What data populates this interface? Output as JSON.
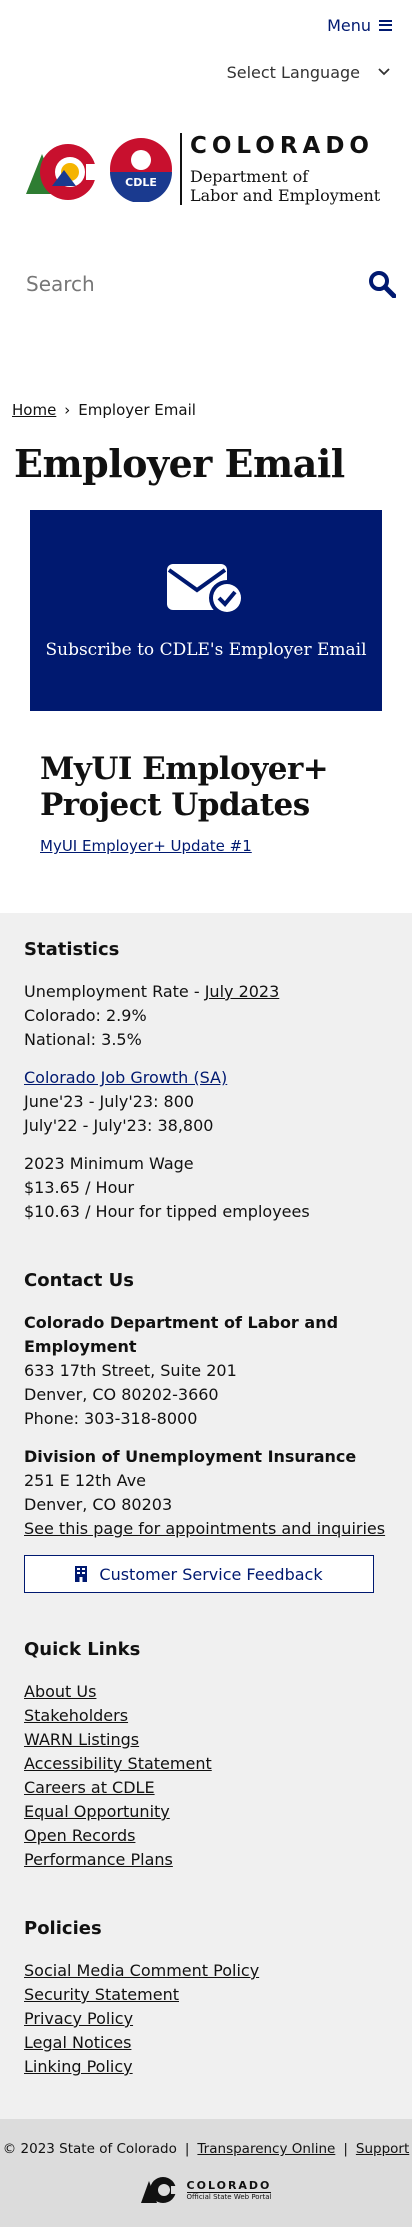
{
  "header": {
    "menu_label": "Menu",
    "language_label": "Select Language",
    "logo_title": "COLORADO",
    "logo_dept_line1": "Department of",
    "logo_dept_line2": "Labor and Employment",
    "logo_badge": "CDLE",
    "search_placeholder": "Search"
  },
  "breadcrumb": {
    "home": "Home",
    "separator": "›",
    "current": "Employer Email"
  },
  "page_title": "Employer Email",
  "banner": {
    "caption": "Subscribe to CDLE's Employer Email"
  },
  "updates": {
    "heading": "MyUI Employer+ Project Updates",
    "link": "MyUI Employer+ Update #1"
  },
  "statistics": {
    "heading": "Statistics",
    "unemployment_prefix": "Unemployment Rate - ",
    "unemployment_link": "July 2023",
    "colorado": "Colorado: 2.9%",
    "national": "National: 3.5%",
    "job_growth_link": "Colorado Job Growth (SA)",
    "growth_1": "June'23 - July'23: 800",
    "growth_2": "July'22 - July'23: 38,800",
    "min_wage_title": "2023 Minimum Wage",
    "min_wage_1": "$13.65 / Hour",
    "min_wage_2": "$10.63 / Hour for tipped employees"
  },
  "contact": {
    "heading": "Contact Us",
    "org": "Colorado Department of Labor and Employment",
    "address1": "633 17th Street, Suite 201",
    "address2": "Denver, CO  80202-3660",
    "phone": "Phone: 303-318-8000",
    "division": "Division of Unemployment Insurance",
    "div_address1": "251 E 12th Ave",
    "div_address2": "Denver, CO  80203",
    "appointments_link": "See this page for appointments and inquiries",
    "feedback_button": "Customer Service Feedback"
  },
  "quick_links": {
    "heading": "Quick Links",
    "items": [
      "About Us",
      "Stakeholders",
      "WARN Listings",
      "Accessibility Statement",
      "Careers at CDLE",
      "Equal Opportunity",
      "Open Records",
      "Performance Plans"
    ]
  },
  "policies": {
    "heading": "Policies",
    "items": [
      "Social Media Comment Policy",
      "Security Statement",
      "Privacy Policy",
      "Legal Notices",
      "Linking Policy"
    ]
  },
  "bottom": {
    "copyright": "© 2023 State of Colorado",
    "sep": "|",
    "transparency": "Transparency Online",
    "support": "Support",
    "portal_title": "COLORADO",
    "portal_sub": "Official State Web Portal"
  },
  "colors": {
    "navy": "#001970",
    "footer_bg": "#f0f0f0",
    "bottom_bg": "#dcdcdc"
  }
}
